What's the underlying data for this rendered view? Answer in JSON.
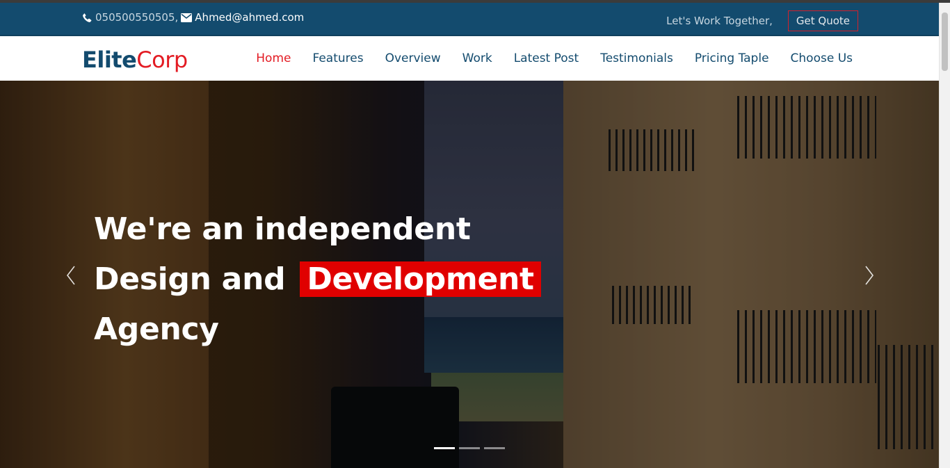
{
  "topbar": {
    "phone": "050500550505,",
    "email": "Ahmed@ahmed.com",
    "tagline": "Let's Work Together,",
    "quote_button": "Get Quote",
    "background_color": "#134b6e",
    "quote_border_color": "#d3212b"
  },
  "brand": {
    "part1": "Elite",
    "part2": "Corp",
    "part1_color": "#134b6e",
    "part2_color": "#e31b23"
  },
  "nav": {
    "items": [
      {
        "label": "Home",
        "active": true
      },
      {
        "label": "Features",
        "active": false
      },
      {
        "label": "Overview",
        "active": false
      },
      {
        "label": "Work",
        "active": false
      },
      {
        "label": "Latest Post",
        "active": false
      },
      {
        "label": "Testimonials",
        "active": false
      },
      {
        "label": "Pricing Taple",
        "active": false
      },
      {
        "label": "Choose Us",
        "active": false
      }
    ],
    "active_color": "#e31b23"
  },
  "hero": {
    "line1": "We're an independent",
    "line2_prefix": "Design and",
    "line2_highlight": "Development",
    "line3": "Agency",
    "highlight_color": "#e00000",
    "carousel": {
      "slides_count": 3,
      "active_index": 0,
      "prev_icon": "chevron-left-icon",
      "next_icon": "chevron-right-icon"
    }
  }
}
